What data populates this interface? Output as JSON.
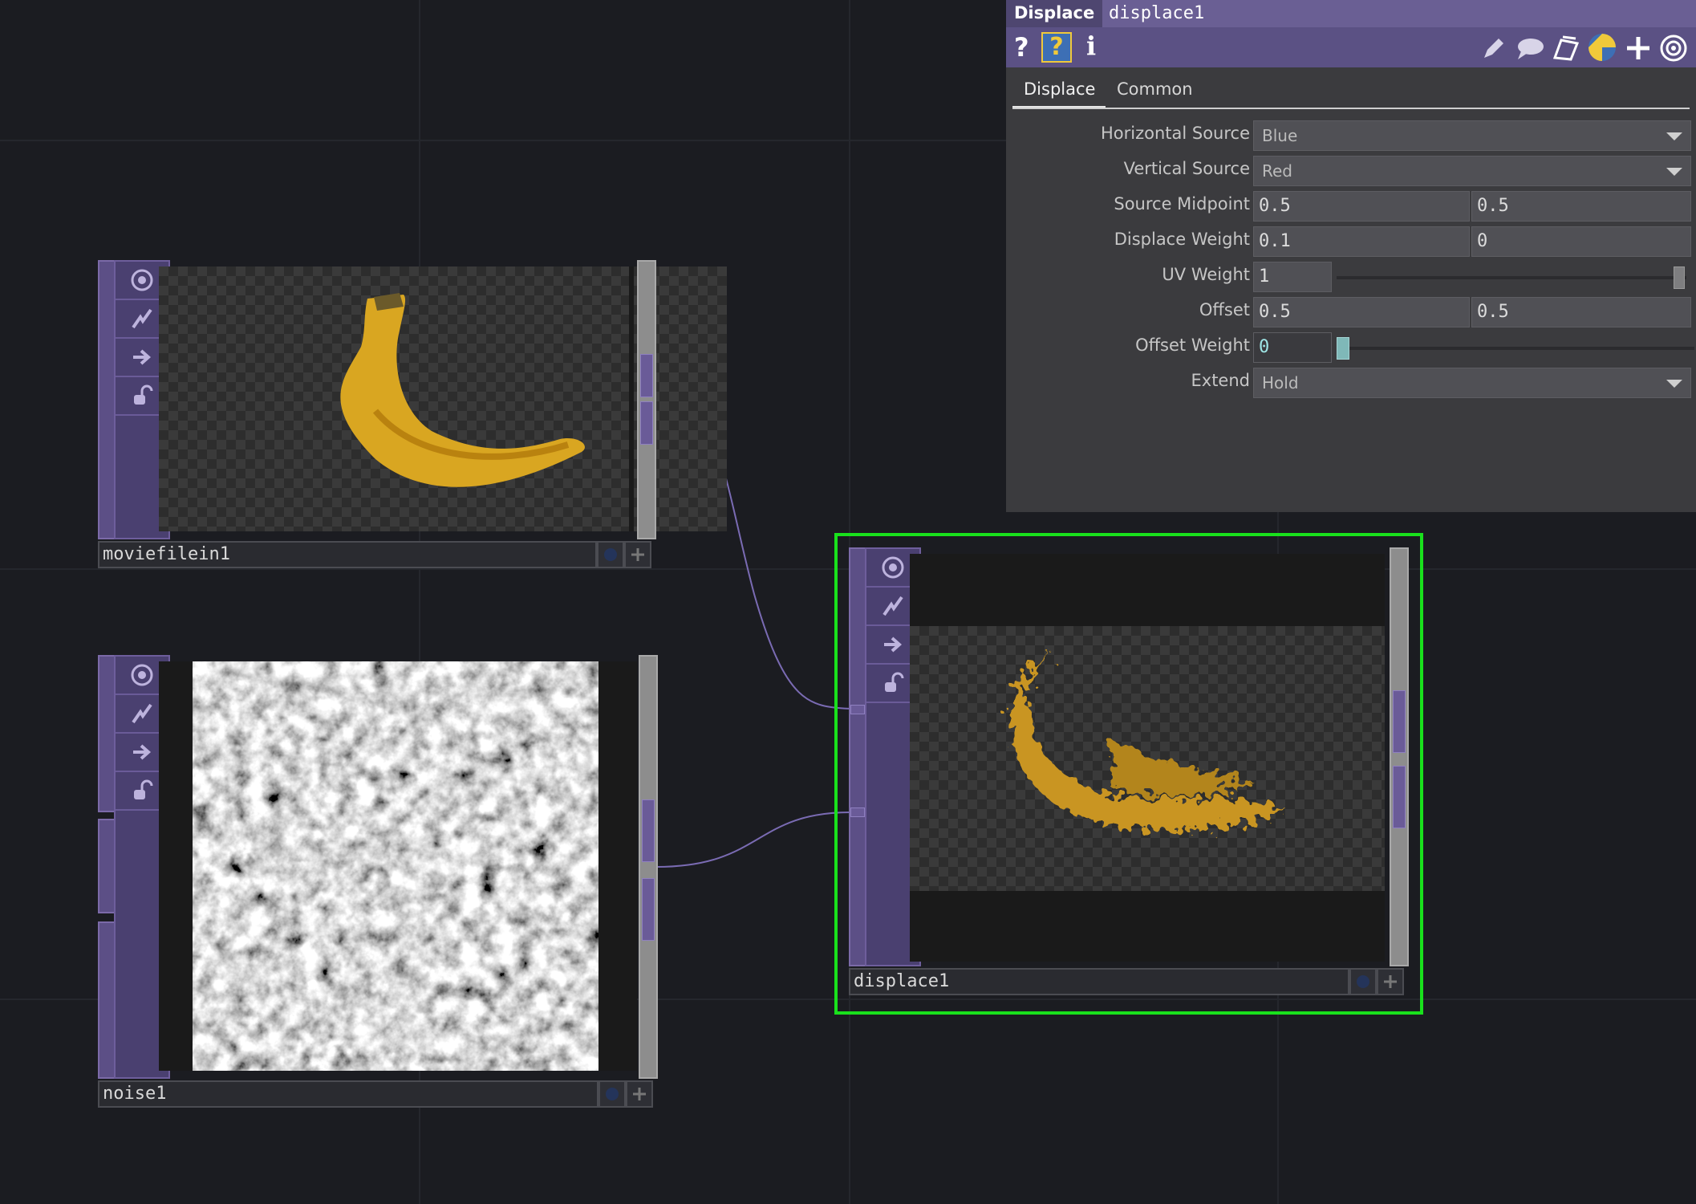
{
  "nodes": {
    "moviefilein": {
      "name": "moviefilein1"
    },
    "noise": {
      "name": "noise1"
    },
    "displace": {
      "name": "displace1"
    }
  },
  "panel": {
    "op_type": "Displace",
    "op_name": "displace1",
    "tools_left": [
      "help-icon",
      "help-python-icon",
      "info-icon"
    ],
    "tools_right": [
      "pencil-icon",
      "comment-icon",
      "clone-icon",
      "python-icon",
      "add-icon",
      "target-icon"
    ],
    "tabs": [
      "Displace",
      "Common"
    ],
    "active_tab": "Displace",
    "params": {
      "horizontal_source": {
        "label": "Horizontal Source",
        "value": "Blue"
      },
      "vertical_source": {
        "label": "Vertical Source",
        "value": "Red"
      },
      "source_midpoint": {
        "label": "Source Midpoint",
        "v1": "0.5",
        "v2": "0.5"
      },
      "displace_weight": {
        "label": "Displace Weight",
        "v1": "0.1",
        "v2": "0"
      },
      "uv_weight": {
        "label": "UV Weight",
        "value": "1",
        "slider_fraction": 1.0
      },
      "offset": {
        "label": "Offset",
        "v1": "0.5",
        "v2": "0.5"
      },
      "offset_weight": {
        "label": "Offset Weight",
        "value": "0",
        "slider_fraction": 0.0
      },
      "extend": {
        "label": "Extend",
        "value": "Hold"
      }
    }
  },
  "colors": {
    "background": "#1b1c21",
    "node_purple": "#5c4f86",
    "selection_green": "#19e11c",
    "wire": "#7a6bb3",
    "panel_header": "#5b5184"
  }
}
